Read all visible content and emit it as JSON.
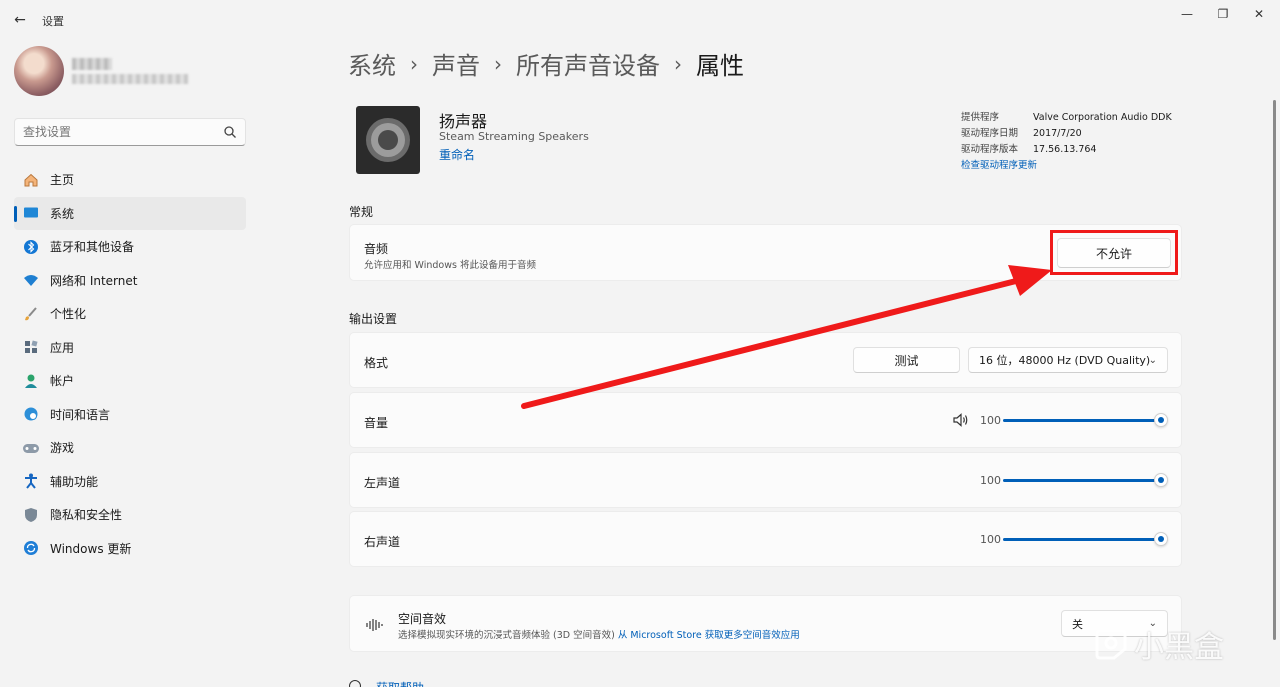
{
  "window": {
    "app_title": "设置",
    "back_symbol": "←",
    "min_symbol": "—",
    "max_symbol": "❐",
    "close_symbol": "✕"
  },
  "search": {
    "placeholder": "查找设置",
    "icon": "search-icon"
  },
  "nav": {
    "items": [
      {
        "label": "主页",
        "icon": "home-icon"
      },
      {
        "label": "系统",
        "icon": "system-icon",
        "active": true
      },
      {
        "label": "蓝牙和其他设备",
        "icon": "bluetooth-icon"
      },
      {
        "label": "网络和 Internet",
        "icon": "wifi-icon"
      },
      {
        "label": "个性化",
        "icon": "brush-icon"
      },
      {
        "label": "应用",
        "icon": "apps-icon"
      },
      {
        "label": "帐户",
        "icon": "account-icon"
      },
      {
        "label": "时间和语言",
        "icon": "globe-clock-icon"
      },
      {
        "label": "游戏",
        "icon": "gamepad-icon"
      },
      {
        "label": "辅助功能",
        "icon": "accessibility-icon"
      },
      {
        "label": "隐私和安全性",
        "icon": "shield-icon"
      },
      {
        "label": "Windows 更新",
        "icon": "update-icon"
      }
    ]
  },
  "breadcrumb": {
    "items": [
      "系统",
      "声音",
      "所有声音设备",
      "属性"
    ],
    "separator": "›"
  },
  "device": {
    "name": "扬声器",
    "subtitle": "Steam Streaming Speakers",
    "rename_label": "重命名"
  },
  "driver": {
    "provider_key": "提供程序",
    "provider_val": "Valve Corporation Audio DDK",
    "date_key": "驱动程序日期",
    "date_val": "2017/7/20",
    "version_key": "驱动程序版本",
    "version_val": "17.56.13.764",
    "update_link": "检查驱动程序更新"
  },
  "general": {
    "section_title": "常规",
    "audio_title": "音频",
    "audio_desc": "允许应用和 Windows 将此设备用于音频",
    "disallow_button": "不允许"
  },
  "output": {
    "section_title": "输出设置",
    "format_label": "格式",
    "test_button": "测试",
    "format_value": "16 位，48000 Hz (DVD Quality)",
    "volume_label": "音量",
    "volume_value": "100",
    "left_label": "左声道",
    "left_value": "100",
    "right_label": "右声道",
    "right_value": "100",
    "slider_levels": {
      "volume": 1.0,
      "left": 1.0,
      "right": 1.0
    }
  },
  "spatial": {
    "title": "空间音效",
    "desc": "选择模拟现实环境的沉浸式音频体验 (3D 空间音效)",
    "store_link": "从 Microsoft Store 获取更多空间音效应用",
    "value": "关"
  },
  "help": {
    "label": "获取帮助"
  },
  "watermark": {
    "text": "小黑盒"
  },
  "colors": {
    "accent": "#005fb8",
    "annotation_red": "#ef1a1a"
  }
}
